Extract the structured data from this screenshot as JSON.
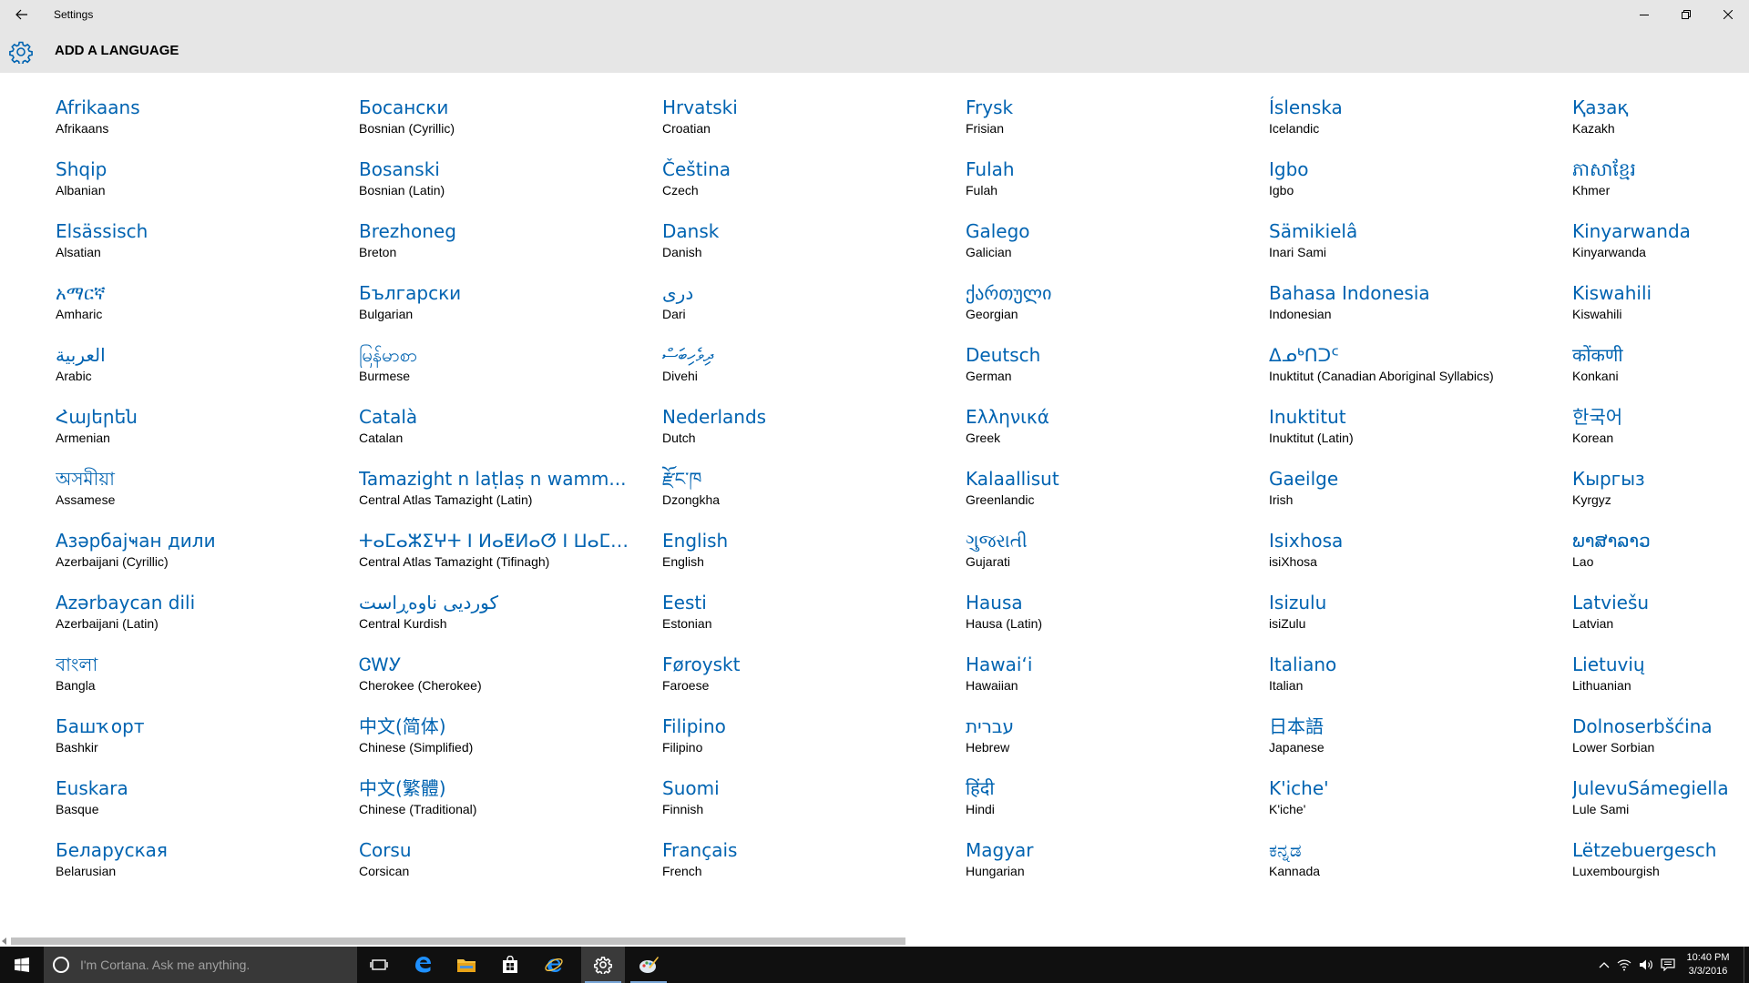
{
  "window": {
    "title": "Settings",
    "back_icon": "back-arrow-icon",
    "minimize_icon": "minimize-icon",
    "restore_icon": "restore-icon",
    "close_icon": "close-icon"
  },
  "header": {
    "icon": "gear-icon",
    "title": "ADD A LANGUAGE"
  },
  "colors": {
    "accent": "#0063b1",
    "titlebar": "#e6e6e6",
    "taskbar": "#101010"
  },
  "languages": [
    {
      "native": "Afrikaans",
      "english": "Afrikaans"
    },
    {
      "native": "Shqip",
      "english": "Albanian"
    },
    {
      "native": "Elsässisch",
      "english": "Alsatian"
    },
    {
      "native": "አማርኛ",
      "english": "Amharic"
    },
    {
      "native": "العربية",
      "english": "Arabic"
    },
    {
      "native": "Հայերեն",
      "english": "Armenian"
    },
    {
      "native": "অসমীয়া",
      "english": "Assamese"
    },
    {
      "native": "Азәрбајҹан дили",
      "english": "Azerbaijani (Cyrillic)"
    },
    {
      "native": "Azərbaycan dili",
      "english": "Azerbaijani (Latin)"
    },
    {
      "native": "বাংলা",
      "english": "Bangla"
    },
    {
      "native": "Башҡорт",
      "english": "Bashkir"
    },
    {
      "native": "Euskara",
      "english": "Basque"
    },
    {
      "native": "Беларуская",
      "english": "Belarusian"
    },
    {
      "native": "Босански",
      "english": "Bosnian (Cyrillic)"
    },
    {
      "native": "Bosanski",
      "english": "Bosnian (Latin)"
    },
    {
      "native": "Brezhoneg",
      "english": "Breton"
    },
    {
      "native": "Български",
      "english": "Bulgarian"
    },
    {
      "native": "မြန်မာစာ",
      "english": "Burmese"
    },
    {
      "native": "Català",
      "english": "Catalan"
    },
    {
      "native": "Tamazight n laṭlaṣ n wamm...",
      "english": "Central Atlas Tamazight (Latin)"
    },
    {
      "native": "ⵜⴰⵎⴰⵣⵉⵖⵜ ⵏ ⵍⴰⵟⵍⴰⵚ ⵏ ⵡⴰⵎⵎⴰⵙ",
      "english": "Central Atlas Tamazight (Tifinagh)"
    },
    {
      "native": "کوردیی ناوەڕاست",
      "english": "Central Kurdish"
    },
    {
      "native": "ᏣᎳᎩ",
      "english": "Cherokee (Cherokee)"
    },
    {
      "native": "中文(简体)",
      "english": "Chinese (Simplified)"
    },
    {
      "native": "中文(繁體)",
      "english": "Chinese (Traditional)"
    },
    {
      "native": "Corsu",
      "english": "Corsican"
    },
    {
      "native": "Hrvatski",
      "english": "Croatian"
    },
    {
      "native": "Čeština",
      "english": "Czech"
    },
    {
      "native": "Dansk",
      "english": "Danish"
    },
    {
      "native": "دری",
      "english": "Dari"
    },
    {
      "native": "ދިވެހިބަސް",
      "english": "Divehi"
    },
    {
      "native": "Nederlands",
      "english": "Dutch"
    },
    {
      "native": "རྫོང་ཁ",
      "english": "Dzongkha"
    },
    {
      "native": "English",
      "english": "English"
    },
    {
      "native": "Eesti",
      "english": "Estonian"
    },
    {
      "native": "Føroyskt",
      "english": "Faroese"
    },
    {
      "native": "Filipino",
      "english": "Filipino"
    },
    {
      "native": "Suomi",
      "english": "Finnish"
    },
    {
      "native": "Français",
      "english": "French"
    },
    {
      "native": "Frysk",
      "english": "Frisian"
    },
    {
      "native": "Fulah",
      "english": "Fulah"
    },
    {
      "native": "Galego",
      "english": "Galician"
    },
    {
      "native": "ქართული",
      "english": "Georgian"
    },
    {
      "native": "Deutsch",
      "english": "German"
    },
    {
      "native": "Ελληνικά",
      "english": "Greek"
    },
    {
      "native": "Kalaallisut",
      "english": "Greenlandic"
    },
    {
      "native": "ગુજરાતી",
      "english": "Gujarati"
    },
    {
      "native": "Hausa",
      "english": "Hausa (Latin)"
    },
    {
      "native": "Hawaiʻi",
      "english": "Hawaiian"
    },
    {
      "native": "עברית",
      "english": "Hebrew"
    },
    {
      "native": "हिंदी",
      "english": "Hindi"
    },
    {
      "native": "Magyar",
      "english": "Hungarian"
    },
    {
      "native": "Íslenska",
      "english": "Icelandic"
    },
    {
      "native": "Igbo",
      "english": "Igbo"
    },
    {
      "native": "Sämikielâ",
      "english": "Inari Sami"
    },
    {
      "native": "Bahasa Indonesia",
      "english": "Indonesian"
    },
    {
      "native": "ᐃᓄᒃᑎᑐᑦ",
      "english": "Inuktitut (Canadian Aboriginal Syllabics)"
    },
    {
      "native": "Inuktitut",
      "english": "Inuktitut (Latin)"
    },
    {
      "native": "Gaeilge",
      "english": "Irish"
    },
    {
      "native": "Isixhosa",
      "english": "isiXhosa"
    },
    {
      "native": "Isizulu",
      "english": "isiZulu"
    },
    {
      "native": "Italiano",
      "english": "Italian"
    },
    {
      "native": "日本語",
      "english": "Japanese"
    },
    {
      "native": "K'iche'",
      "english": "K'iche'"
    },
    {
      "native": "ಕನ್ನಡ",
      "english": "Kannada"
    },
    {
      "native": "Қазақ",
      "english": "Kazakh"
    },
    {
      "native": "ភាសាខ្មែរ",
      "english": "Khmer"
    },
    {
      "native": "Kinyarwanda",
      "english": "Kinyarwanda"
    },
    {
      "native": "Kiswahili",
      "english": "Kiswahili"
    },
    {
      "native": "कोंकणी",
      "english": "Konkani"
    },
    {
      "native": "한국어",
      "english": "Korean"
    },
    {
      "native": "Кыргыз",
      "english": "Kyrgyz"
    },
    {
      "native": "ພາສາລາວ",
      "english": "Lao"
    },
    {
      "native": "Latviešu",
      "english": "Latvian"
    },
    {
      "native": "Lietuvių",
      "english": "Lithuanian"
    },
    {
      "native": "Dolnoserbšćina",
      "english": "Lower Sorbian"
    },
    {
      "native": "JulevuSámegiella",
      "english": "Lule Sami"
    },
    {
      "native": "Lëtzebuergesch",
      "english": "Luxembourgish"
    }
  ],
  "taskbar": {
    "search_placeholder": "I'm Cortana. Ask me anything.",
    "time": "10:40 PM",
    "date": "3/3/2016"
  }
}
